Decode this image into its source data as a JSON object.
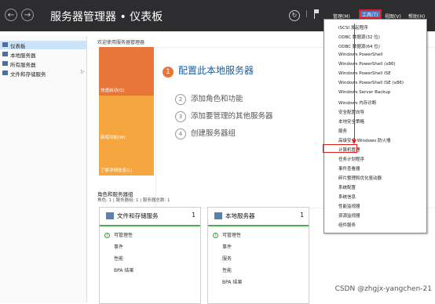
{
  "titlebar": {
    "back_glyph": "←",
    "forward_glyph": "→",
    "title": "服务器管理器 • 仪表板",
    "refresh_glyph": "↻",
    "separator": "|",
    "menus": [
      "管理(M)",
      "工具(T)",
      "视图(V)",
      "帮助(H)"
    ],
    "active_menu_index": 1,
    "active_menu_color": "#4a78c8",
    "highlight_color": "#e01c1c"
  },
  "sidebar": {
    "items": [
      {
        "label": "仪表板",
        "selected": true
      },
      {
        "label": "本地服务器",
        "selected": false
      },
      {
        "label": "所有服务器",
        "selected": false
      },
      {
        "label": "文件和存储服务",
        "selected": false,
        "has_chevron": true
      }
    ],
    "chevron_glyph": "▷"
  },
  "main": {
    "welcome_title": "欢迎使用服务器管理器",
    "quick_start": [
      {
        "label": "快速启动(Q)",
        "color": "#e8763a"
      },
      {
        "label": "新增功能(W)",
        "color": "#f5a63f"
      },
      {
        "label": "了解详细信息(L)",
        "color": "#f5a63f"
      }
    ],
    "tasks": [
      {
        "num": "1",
        "label": "配置此本地服务器"
      },
      {
        "num": "2",
        "label": "添加角色和功能"
      },
      {
        "num": "3",
        "label": "添加要管理的其他服务器"
      },
      {
        "num": "4",
        "label": "创建服务器组"
      }
    ],
    "roles_title": "角色和服务器组",
    "roles_sub": "角色: 1 | 服务器组: 1 | 服务器总数: 1",
    "tiles": [
      {
        "title": "文件和存储服务",
        "count": "1",
        "rows": [
          "可管理性",
          "事件",
          "性能",
          "BPA 结果"
        ]
      },
      {
        "title": "本地服务器",
        "count": "1",
        "rows": [
          "可管理性",
          "事件",
          "服务",
          "性能",
          "BPA 结果"
        ]
      }
    ]
  },
  "tools_menu": {
    "items": [
      "iSCSI 发起程序",
      "ODBC 数据源(32 位)",
      "ODBC 数据源(64 位)",
      "Windows PowerShell",
      "Windows PowerShell (x86)",
      "Windows PowerShell ISE",
      "Windows PowerShell ISE (x86)",
      "Windows Server Backup",
      "Windows 内存诊断",
      "安全配置向导",
      "本地安全策略",
      "服务",
      "高级安全 Windows 防火墙",
      "计算机管理",
      "任务计划程序",
      "事件查看器",
      "碎片整理和优化驱动器",
      "系统配置",
      "系统信息",
      "性能监视器",
      "资源监视器",
      "组件服务"
    ],
    "highlighted_index": 13
  },
  "watermark": "CSDN @zhgjx-yangchen-21"
}
